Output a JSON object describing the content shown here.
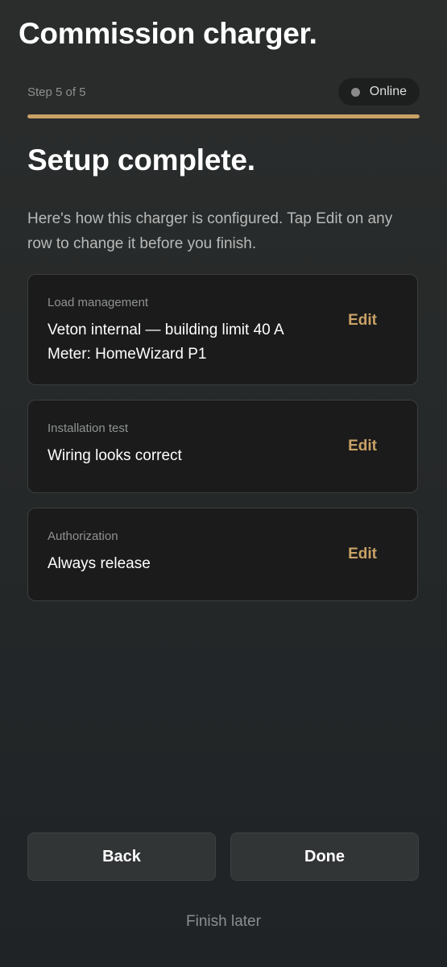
{
  "header": {
    "title": "Commission charger."
  },
  "progress": {
    "step_text": "Step 5 of 5",
    "current_step": 5,
    "total_steps": 5,
    "fraction": 1.0,
    "accent_color": "#c9a266"
  },
  "status": {
    "label": "Online",
    "dot_color": "#8a8a8a"
  },
  "content": {
    "title": "Setup complete.",
    "intro": "Here's how this charger is configured. Tap Edit on any row to change it before you finish."
  },
  "cards": [
    {
      "label": "Load management",
      "value_lines": [
        "Veton internal — building limit 40 A",
        "Meter: HomeWizard P1"
      ],
      "edit_label": "Edit"
    },
    {
      "label": "Installation test",
      "value_lines": [
        "Wiring looks correct"
      ],
      "edit_label": "Edit"
    },
    {
      "label": "Authorization",
      "value_lines": [
        "Always release"
      ],
      "edit_label": "Edit"
    }
  ],
  "actions": {
    "back_label": "Back",
    "done_label": "Done",
    "finish_later_label": "Finish later"
  }
}
